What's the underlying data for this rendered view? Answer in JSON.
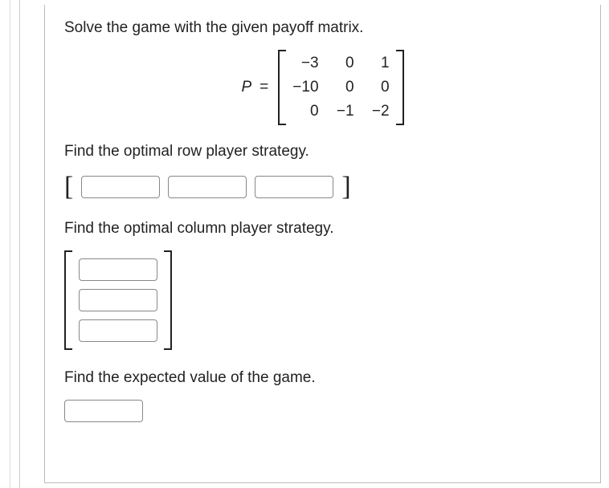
{
  "question": {
    "intro": "Solve the game with the given payoff matrix.",
    "matrix_label": "P",
    "matrix_eq": "=",
    "matrix": {
      "r0c0": "−3",
      "r0c1": "0",
      "r0c2": "1",
      "r1c0": "−10",
      "r1c1": "0",
      "r1c2": "0",
      "r2c0": "0",
      "r2c1": "−1",
      "r2c2": "−2"
    },
    "row_prompt": "Find the optimal row player strategy.",
    "col_prompt": "Find the optimal column player strategy.",
    "ev_prompt": "Find the expected value of the game."
  }
}
